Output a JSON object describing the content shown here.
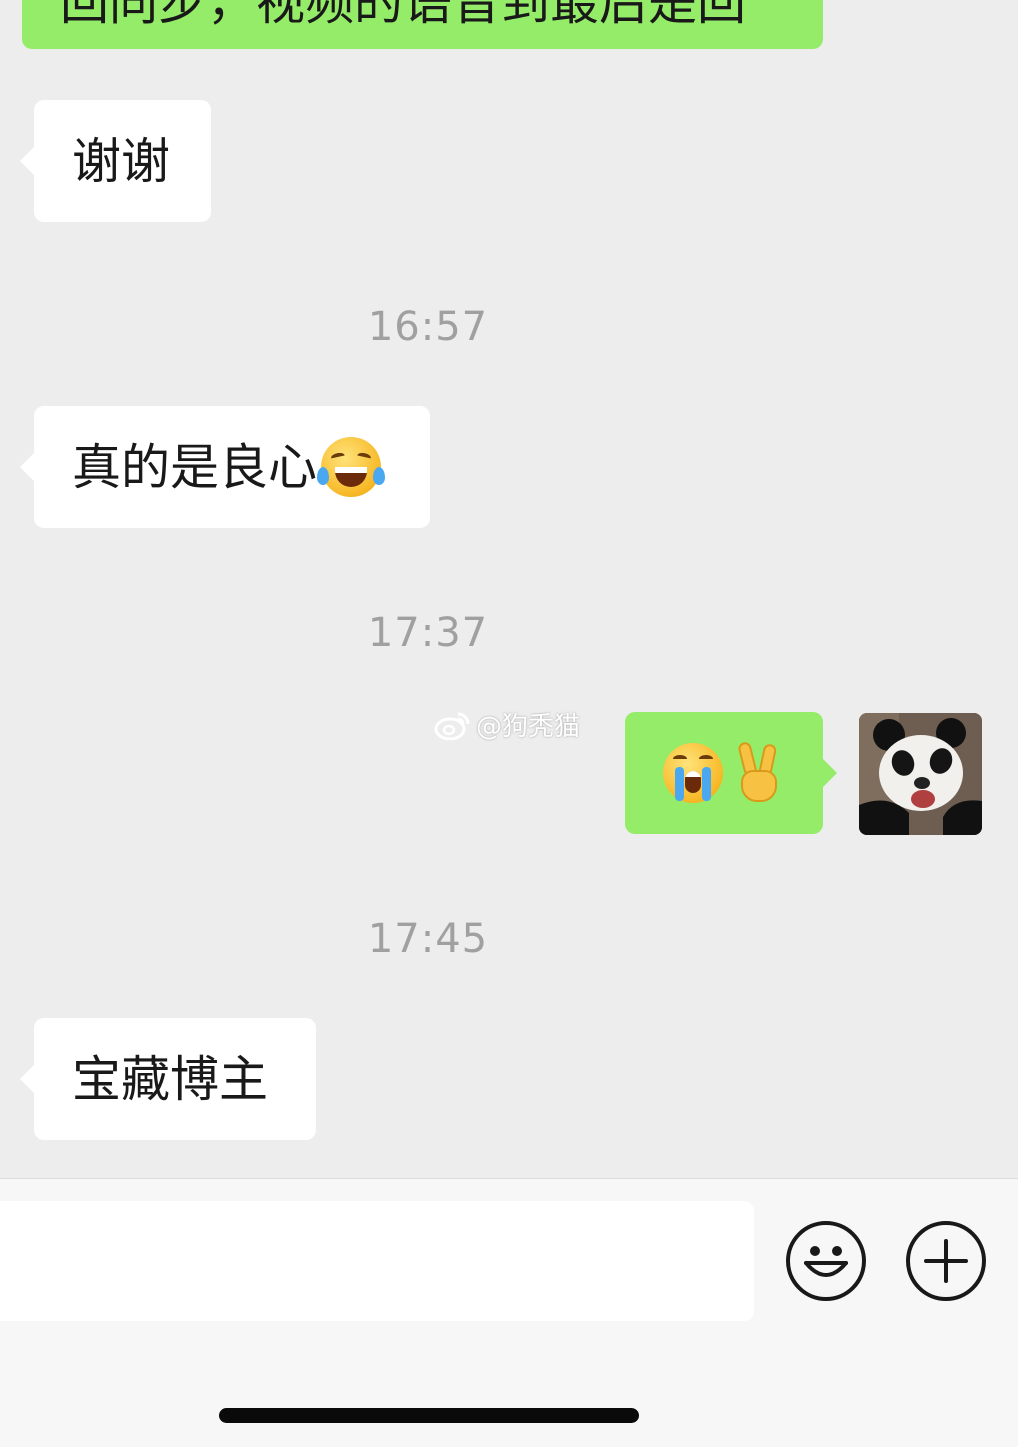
{
  "messages": {
    "top_partial": "回同步，视频的语音到最后是回",
    "msg_thanks": "谢谢",
    "time_1": "16:57",
    "msg_conscience": "真的是良心",
    "time_2": "17:37",
    "time_3": "17:45",
    "msg_treasure": "宝藏博主"
  },
  "watermark": {
    "text": "@狗秃猫"
  },
  "emoji": {
    "laughing": "face-with-tears-of-joy",
    "crying": "loudly-crying-face",
    "victory": "victory-hand"
  },
  "input_bar": {
    "emoji_button": "emoji-icon",
    "plus_button": "plus-icon"
  },
  "colors": {
    "background": "#ededed",
    "incoming_bubble": "#ffffff",
    "outgoing_bubble": "#95ec69",
    "timestamp": "#a0a0a0"
  }
}
